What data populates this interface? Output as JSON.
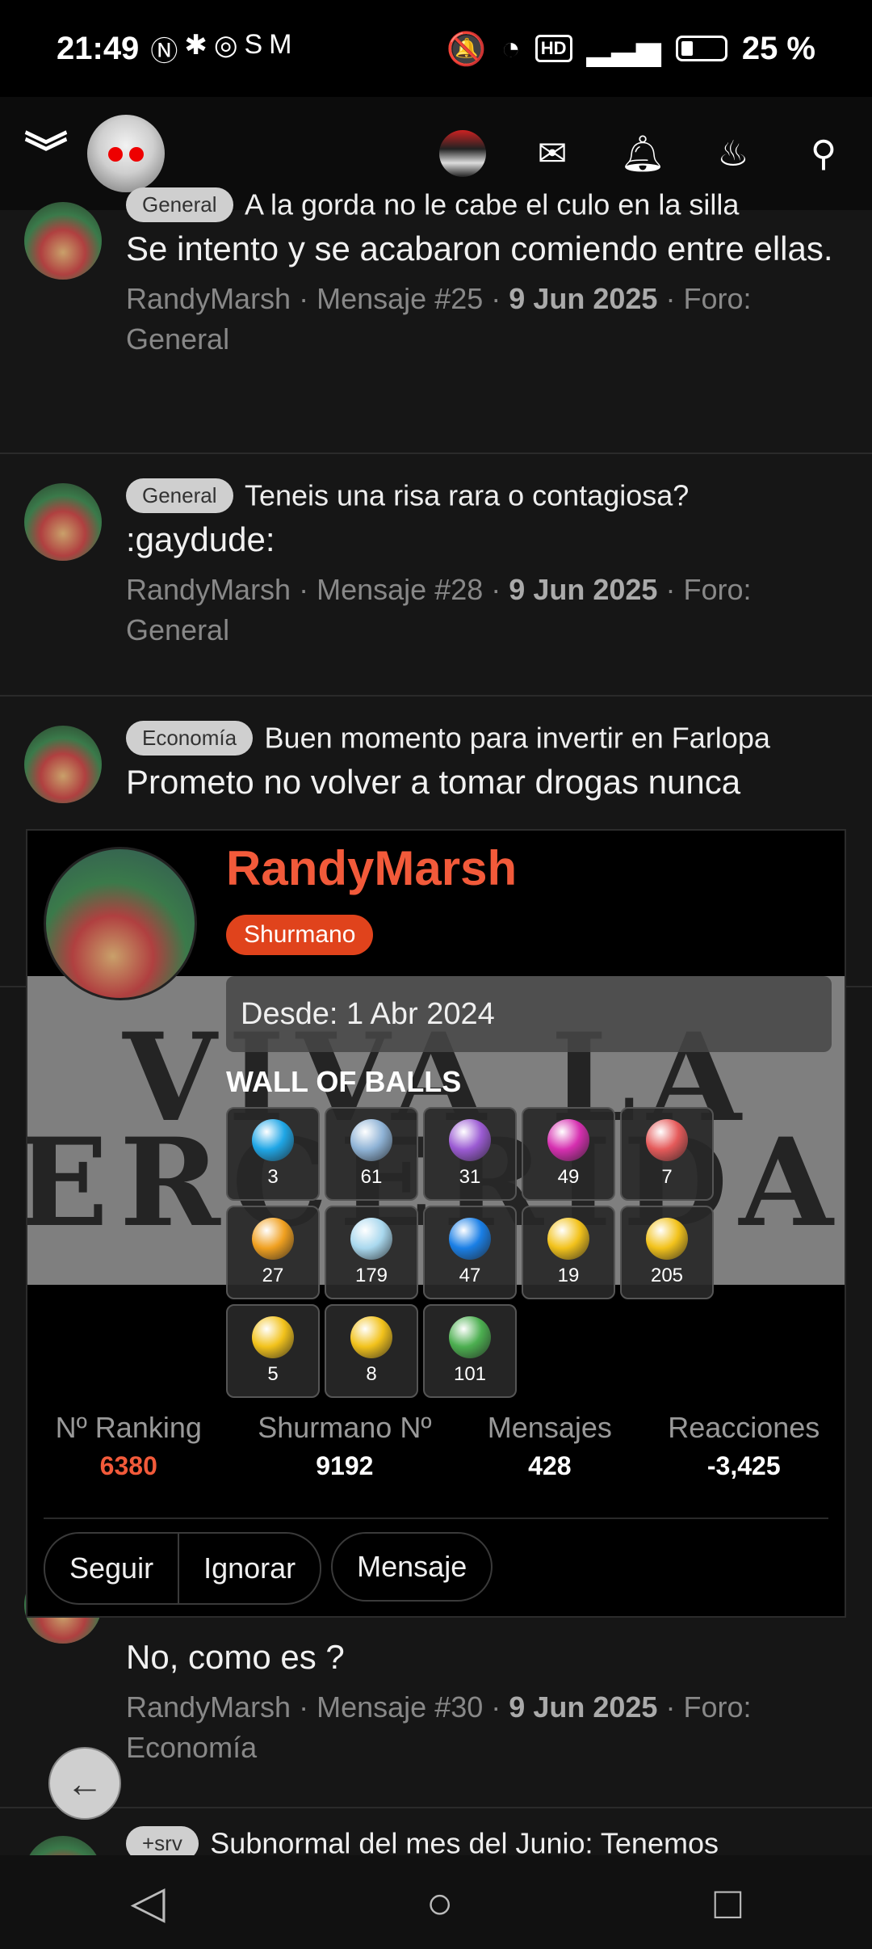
{
  "status_bar": {
    "time": "21:49",
    "left_icons": [
      "nfc-icon",
      "bluetooth-icon",
      "whatsapp-icon",
      "s-icon",
      "gmail-icon"
    ],
    "battery": "25 %",
    "hd": "HD"
  },
  "topbar": {
    "icons": [
      "chevrons-down-icon",
      "site-logo-robot",
      "user-avatar",
      "envelope-icon",
      "bell-icon",
      "fire-icon",
      "search-icon"
    ]
  },
  "posts": [
    {
      "tag": "General",
      "title": "A la gorda no le cabe el culo en la silla",
      "text": "Se intento y se acabaron comiendo entre ellas.",
      "author": "RandyMarsh",
      "message": "Mensaje #25",
      "date": "9 Jun 2025",
      "forum_label": "Foro:",
      "forum": "General"
    },
    {
      "tag": "General",
      "title": "Teneis una risa rara o contagiosa?",
      "text": ":gaydude:",
      "author": "RandyMarsh",
      "message": "Mensaje #28",
      "date": "9 Jun 2025",
      "forum_label": "Foro:",
      "forum": "General"
    },
    {
      "tag": "Economía",
      "title": "Buen momento para invertir en Farlopa",
      "text": "Prometo no volver a tomar drogas nunca",
      "author": "",
      "message": "",
      "date": "",
      "forum_label": "",
      "forum": ""
    },
    {
      "tag": "",
      "title": "",
      "text": "No, como es ?",
      "author": "RandyMarsh",
      "message": "Mensaje #30",
      "date": "9 Jun 2025",
      "forum_label": "Foro:",
      "forum": "Economía"
    },
    {
      "tag": "+srv",
      "title": "Subnormal del mes del Junio: Tenemos",
      "text": ""
    }
  ],
  "separator": "·",
  "card": {
    "username": "RandyMarsh",
    "rank": "Shurmano",
    "banner_text_line1": "VIVA LA",
    "banner_text_line2": "TERCERIDAD",
    "since": "Desde: 1 Abr 2024",
    "wall_title": "WALL OF BALLS",
    "balls": [
      {
        "icon": "blue-gem-icon",
        "color": "#1fa6e6",
        "count": "3"
      },
      {
        "icon": "silver-gem-icon",
        "color": "#8fb3d6",
        "count": "61"
      },
      {
        "icon": "purple-gem-icon",
        "color": "#9b5bd3",
        "count": "31"
      },
      {
        "icon": "magenta-gem-icon",
        "color": "#d62fb0",
        "count": "49"
      },
      {
        "icon": "red-gem-icon",
        "color": "#e55a5a",
        "count": "7"
      },
      {
        "icon": "gold-gem-icon",
        "color": "#f0a020",
        "count": "27"
      },
      {
        "icon": "diamond-icon",
        "color": "#a9d8ee",
        "count": "179"
      },
      {
        "icon": "thumbs-up-icon",
        "color": "#1a7fe6",
        "count": "47"
      },
      {
        "icon": "astonished-face-icon",
        "color": "#f2c21b",
        "count": "19"
      },
      {
        "icon": "rofl-face-icon",
        "color": "#f2c21b",
        "count": "205"
      },
      {
        "icon": "heart-eyes-face-icon",
        "color": "#f2c21b",
        "count": "5"
      },
      {
        "icon": "confused-face-icon",
        "color": "#f2c21b",
        "count": "8"
      },
      {
        "icon": "grinch-icon",
        "color": "#4caf50",
        "count": "101"
      }
    ],
    "stats": [
      {
        "label": "Nº Ranking",
        "value": "6380"
      },
      {
        "label": "Shurmano Nº",
        "value": "9192"
      },
      {
        "label": "Mensajes",
        "value": "428"
      },
      {
        "label": "Reacciones",
        "value": "-3,425"
      }
    ],
    "buttons": {
      "follow": "Seguir",
      "ignore": "Ignorar",
      "message": "Mensaje"
    }
  },
  "back_icon": "arrow-left-icon",
  "navbar": {
    "back": "◁",
    "home": "○",
    "recents": "□"
  }
}
